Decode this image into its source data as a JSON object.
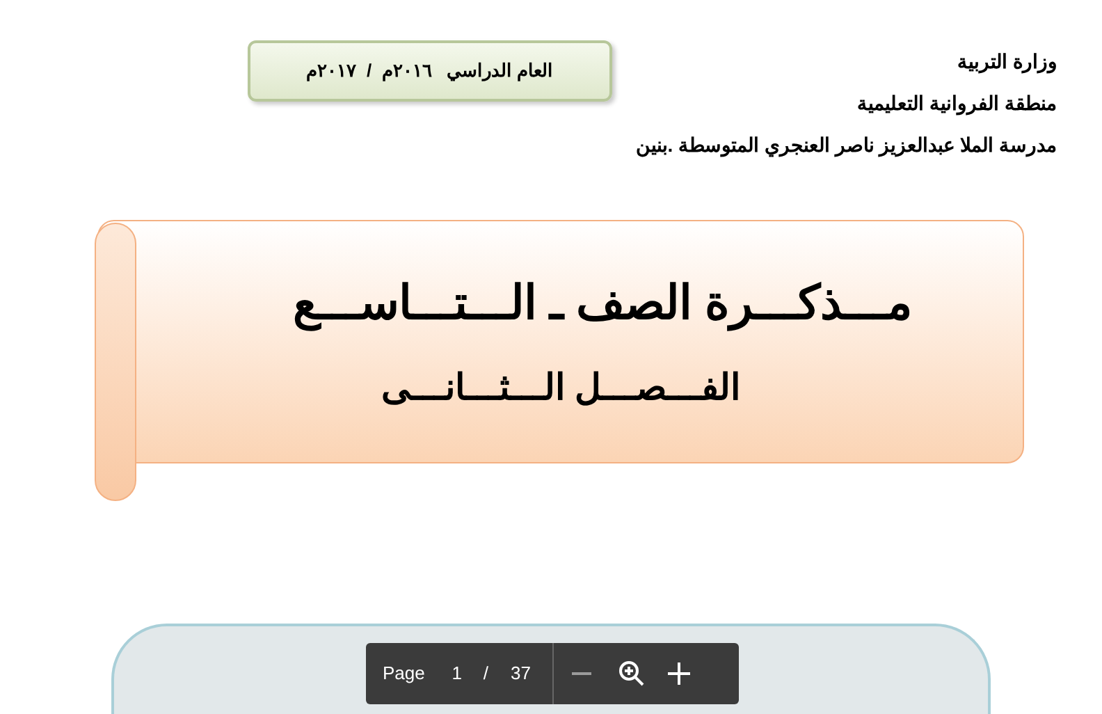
{
  "header": {
    "lines": [
      "وزارة التربية",
      "منطقة الفروانية التعليمية",
      "مدرسة الملا عبدالعزيز ناصر العنجري المتوسطة .بنين"
    ]
  },
  "year_banner": {
    "text": "العام الدراسي   ٢٠١٦م  /  ٢٠١٧م"
  },
  "title_banner": {
    "title": "مـــذكـــرة الصف ـ الـــتـــاســـع",
    "subtitle": "الفـــصـــل الـــثـــانـــى"
  },
  "toolbar": {
    "page_label": "Page",
    "current_page": "1",
    "separator": "/",
    "total_pages": "37"
  }
}
